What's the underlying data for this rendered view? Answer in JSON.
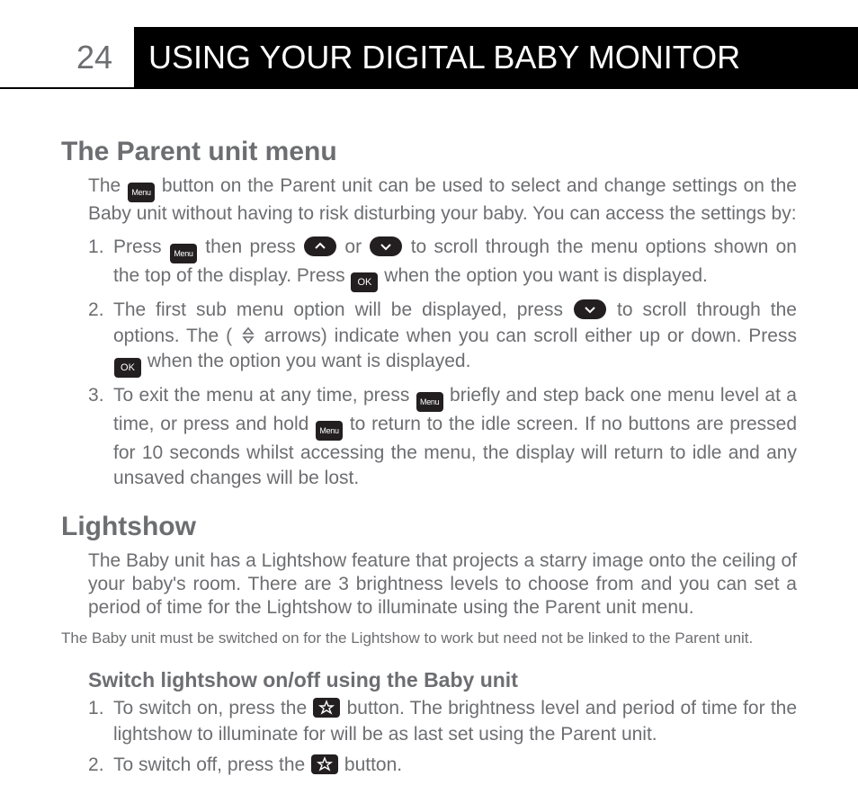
{
  "header": {
    "page_number": "24",
    "chapter_title": "USING YOUR DIGITAL BABY MONITOR"
  },
  "icons": {
    "menu": "Menu",
    "ok": "OK"
  },
  "section1": {
    "title": "The Parent unit menu",
    "intro_a": "The",
    "intro_b": "button on the Parent unit can be used to select and change settings on the Baby unit without having to risk disturbing your baby. You can access the settings by:",
    "step1_a": "Press",
    "step1_b": "then press",
    "step1_c": "or",
    "step1_d": "to scroll through the menu options shown on the top of the display. Press",
    "step1_e": "when the option you want is displayed.",
    "step2_a": "The first sub menu option will be displayed, press",
    "step2_b": "to scroll through the options. The (",
    "step2_c": "arrows) indicate when you can scroll either up or down. Press",
    "step2_d": "when the option you want is displayed.",
    "step3_a": "To exit the menu at any time, press",
    "step3_b": "briefly and step back one menu level at a time, or press and hold",
    "step3_c": "to return to the idle screen. If no buttons are pressed for 10 seconds whilst accessing the menu, the display will return to idle and any unsaved changes will be lost."
  },
  "section2": {
    "title": "Lightshow",
    "intro": "The Baby unit has a Lightshow feature that projects a starry image onto the ceiling of your baby's room. There are 3 brightness levels to choose from and you can set a period of time for the Lightshow to illuminate using the Parent unit menu.",
    "note": "The Baby unit must be switched on for the Lightshow to work but need not be linked to the Parent unit.",
    "sub_title": "Switch lightshow on/off using the Baby unit",
    "step1_a": "To switch on, press the",
    "step1_b": "button. The brightness level and period of time for the lightshow to illuminate for will be as last set using the Parent unit.",
    "step2_a": "To switch off, press the",
    "step2_b": "button."
  }
}
